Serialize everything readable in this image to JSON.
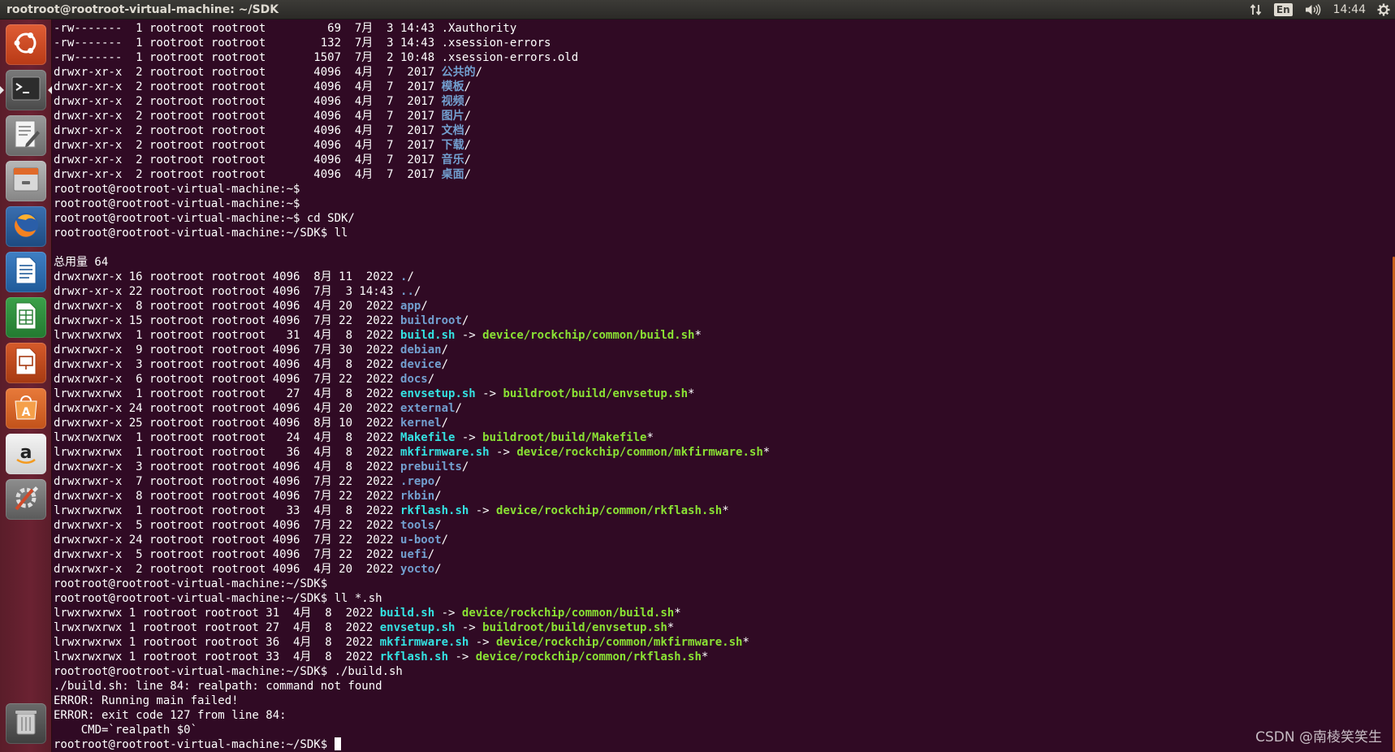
{
  "window": {
    "title": "rootroot@rootroot-virtual-machine: ~/SDK"
  },
  "panel": {
    "keyboard_layout": "En",
    "time": "14:44",
    "icons": [
      "network-arrows-icon",
      "keyboard-layout-indicator",
      "volume-icon",
      "gear-icon"
    ]
  },
  "launcher": {
    "items": [
      {
        "name": "dash-home",
        "icon": "ubuntu-logo-icon"
      },
      {
        "name": "terminal",
        "icon": "terminal-icon",
        "active": true
      },
      {
        "name": "text-editor",
        "icon": "text-editor-icon"
      },
      {
        "name": "files",
        "icon": "file-cabinet-icon"
      },
      {
        "name": "firefox",
        "icon": "firefox-icon"
      },
      {
        "name": "libreoffice-writer",
        "icon": "writer-document-icon"
      },
      {
        "name": "libreoffice-calc",
        "icon": "calc-spreadsheet-icon"
      },
      {
        "name": "libreoffice-impress",
        "icon": "impress-presentation-icon"
      },
      {
        "name": "software-center",
        "icon": "shopping-bag-icon"
      },
      {
        "name": "amazon",
        "icon": "amazon-icon"
      },
      {
        "name": "system-settings",
        "icon": "settings-tools-icon"
      },
      {
        "name": "trash",
        "icon": "trash-icon"
      }
    ],
    "colors": {
      "background": "#6b2232",
      "terminal_bg": "#300a24"
    }
  },
  "terminal": {
    "lines": [
      [
        {
          "t": "-rw-------  1 rootroot rootroot         69  7月  3 14:43 .Xauthority"
        }
      ],
      [
        {
          "t": "-rw-------  1 rootroot rootroot        132  7月  3 14:43 .xsession-errors"
        }
      ],
      [
        {
          "t": "-rw-------  1 rootroot rootroot       1507  7月  2 10:48 .xsession-errors.old"
        }
      ],
      [
        {
          "t": "drwxr-xr-x  2 rootroot rootroot       4096  4月  7  2017 "
        },
        {
          "t": "公共的",
          "c": "dir"
        },
        {
          "t": "/"
        }
      ],
      [
        {
          "t": "drwxr-xr-x  2 rootroot rootroot       4096  4月  7  2017 "
        },
        {
          "t": "模板",
          "c": "dir"
        },
        {
          "t": "/"
        }
      ],
      [
        {
          "t": "drwxr-xr-x  2 rootroot rootroot       4096  4月  7  2017 "
        },
        {
          "t": "视频",
          "c": "dir"
        },
        {
          "t": "/"
        }
      ],
      [
        {
          "t": "drwxr-xr-x  2 rootroot rootroot       4096  4月  7  2017 "
        },
        {
          "t": "图片",
          "c": "dir"
        },
        {
          "t": "/"
        }
      ],
      [
        {
          "t": "drwxr-xr-x  2 rootroot rootroot       4096  4月  7  2017 "
        },
        {
          "t": "文档",
          "c": "dir"
        },
        {
          "t": "/"
        }
      ],
      [
        {
          "t": "drwxr-xr-x  2 rootroot rootroot       4096  4月  7  2017 "
        },
        {
          "t": "下载",
          "c": "dir"
        },
        {
          "t": "/"
        }
      ],
      [
        {
          "t": "drwxr-xr-x  2 rootroot rootroot       4096  4月  7  2017 "
        },
        {
          "t": "音乐",
          "c": "dir"
        },
        {
          "t": "/"
        }
      ],
      [
        {
          "t": "drwxr-xr-x  2 rootroot rootroot       4096  4月  7  2017 "
        },
        {
          "t": "桌面",
          "c": "dir"
        },
        {
          "t": "/"
        }
      ],
      [
        {
          "t": "rootroot@rootroot-virtual-machine:~$"
        }
      ],
      [
        {
          "t": "rootroot@rootroot-virtual-machine:~$"
        }
      ],
      [
        {
          "t": "rootroot@rootroot-virtual-machine:~$ cd SDK/"
        }
      ],
      [
        {
          "t": "rootroot@rootroot-virtual-machine:~/SDK$ ll"
        }
      ],
      [
        {
          "t": ""
        }
      ],
      [
        {
          "t": "总用量 64"
        }
      ],
      [
        {
          "t": "drwxrwxr-x 16 rootroot rootroot 4096  8月 11  2022 "
        },
        {
          "t": ".",
          "c": "dir"
        },
        {
          "t": "/"
        }
      ],
      [
        {
          "t": "drwxr-xr-x 22 rootroot rootroot 4096  7月  3 14:43 "
        },
        {
          "t": "..",
          "c": "dir"
        },
        {
          "t": "/"
        }
      ],
      [
        {
          "t": "drwxrwxr-x  8 rootroot rootroot 4096  4月 20  2022 "
        },
        {
          "t": "app",
          "c": "dir"
        },
        {
          "t": "/"
        }
      ],
      [
        {
          "t": "drwxrwxr-x 15 rootroot rootroot 4096  7月 22  2022 "
        },
        {
          "t": "buildroot",
          "c": "dir"
        },
        {
          "t": "/"
        }
      ],
      [
        {
          "t": "lrwxrwxrwx  1 rootroot rootroot   31  4月  8  2022 "
        },
        {
          "t": "build.sh",
          "c": "link"
        },
        {
          "t": " -> "
        },
        {
          "t": "device/rockchip/common/build.sh",
          "c": "exe"
        },
        {
          "t": "*"
        }
      ],
      [
        {
          "t": "drwxrwxr-x  9 rootroot rootroot 4096  7月 30  2022 "
        },
        {
          "t": "debian",
          "c": "dir"
        },
        {
          "t": "/"
        }
      ],
      [
        {
          "t": "drwxrwxr-x  3 rootroot rootroot 4096  4月  8  2022 "
        },
        {
          "t": "device",
          "c": "dir"
        },
        {
          "t": "/"
        }
      ],
      [
        {
          "t": "drwxrwxr-x  6 rootroot rootroot 4096  7月 22  2022 "
        },
        {
          "t": "docs",
          "c": "dir"
        },
        {
          "t": "/"
        }
      ],
      [
        {
          "t": "lrwxrwxrwx  1 rootroot rootroot   27  4月  8  2022 "
        },
        {
          "t": "envsetup.sh",
          "c": "link"
        },
        {
          "t": " -> "
        },
        {
          "t": "buildroot/build/envsetup.sh",
          "c": "exe"
        },
        {
          "t": "*"
        }
      ],
      [
        {
          "t": "drwxrwxr-x 24 rootroot rootroot 4096  4月 20  2022 "
        },
        {
          "t": "external",
          "c": "dir"
        },
        {
          "t": "/"
        }
      ],
      [
        {
          "t": "drwxrwxr-x 25 rootroot rootroot 4096  8月 10  2022 "
        },
        {
          "t": "kernel",
          "c": "dir"
        },
        {
          "t": "/"
        }
      ],
      [
        {
          "t": "lrwxrwxrwx  1 rootroot rootroot   24  4月  8  2022 "
        },
        {
          "t": "Makefile",
          "c": "link"
        },
        {
          "t": " -> "
        },
        {
          "t": "buildroot/build/Makefile",
          "c": "exe"
        },
        {
          "t": "*"
        }
      ],
      [
        {
          "t": "lrwxrwxrwx  1 rootroot rootroot   36  4月  8  2022 "
        },
        {
          "t": "mkfirmware.sh",
          "c": "link"
        },
        {
          "t": " -> "
        },
        {
          "t": "device/rockchip/common/mkfirmware.sh",
          "c": "exe"
        },
        {
          "t": "*"
        }
      ],
      [
        {
          "t": "drwxrwxr-x  3 rootroot rootroot 4096  4月  8  2022 "
        },
        {
          "t": "prebuilts",
          "c": "dir"
        },
        {
          "t": "/"
        }
      ],
      [
        {
          "t": "drwxrwxr-x  7 rootroot rootroot 4096  7月 22  2022 "
        },
        {
          "t": ".repo",
          "c": "dir"
        },
        {
          "t": "/"
        }
      ],
      [
        {
          "t": "drwxrwxr-x  8 rootroot rootroot 4096  7月 22  2022 "
        },
        {
          "t": "rkbin",
          "c": "dir"
        },
        {
          "t": "/"
        }
      ],
      [
        {
          "t": "lrwxrwxrwx  1 rootroot rootroot   33  4月  8  2022 "
        },
        {
          "t": "rkflash.sh",
          "c": "link"
        },
        {
          "t": " -> "
        },
        {
          "t": "device/rockchip/common/rkflash.sh",
          "c": "exe"
        },
        {
          "t": "*"
        }
      ],
      [
        {
          "t": "drwxrwxr-x  5 rootroot rootroot 4096  7月 22  2022 "
        },
        {
          "t": "tools",
          "c": "dir"
        },
        {
          "t": "/"
        }
      ],
      [
        {
          "t": "drwxrwxr-x 24 rootroot rootroot 4096  7月 22  2022 "
        },
        {
          "t": "u-boot",
          "c": "dir"
        },
        {
          "t": "/"
        }
      ],
      [
        {
          "t": "drwxrwxr-x  5 rootroot rootroot 4096  7月 22  2022 "
        },
        {
          "t": "uefi",
          "c": "dir"
        },
        {
          "t": "/"
        }
      ],
      [
        {
          "t": "drwxrwxr-x  2 rootroot rootroot 4096  4月 20  2022 "
        },
        {
          "t": "yocto",
          "c": "dir"
        },
        {
          "t": "/"
        }
      ],
      [
        {
          "t": "rootroot@rootroot-virtual-machine:~/SDK$"
        }
      ],
      [
        {
          "t": "rootroot@rootroot-virtual-machine:~/SDK$ ll *.sh"
        }
      ],
      [
        {
          "t": "lrwxrwxrwx 1 rootroot rootroot 31  4月  8  2022 "
        },
        {
          "t": "build.sh",
          "c": "link"
        },
        {
          "t": " -> "
        },
        {
          "t": "device/rockchip/common/build.sh",
          "c": "exe"
        },
        {
          "t": "*"
        }
      ],
      [
        {
          "t": "lrwxrwxrwx 1 rootroot rootroot 27  4月  8  2022 "
        },
        {
          "t": "envsetup.sh",
          "c": "link"
        },
        {
          "t": " -> "
        },
        {
          "t": "buildroot/build/envsetup.sh",
          "c": "exe"
        },
        {
          "t": "*"
        }
      ],
      [
        {
          "t": "lrwxrwxrwx 1 rootroot rootroot 36  4月  8  2022 "
        },
        {
          "t": "mkfirmware.sh",
          "c": "link"
        },
        {
          "t": " -> "
        },
        {
          "t": "device/rockchip/common/mkfirmware.sh",
          "c": "exe"
        },
        {
          "t": "*"
        }
      ],
      [
        {
          "t": "lrwxrwxrwx 1 rootroot rootroot 33  4月  8  2022 "
        },
        {
          "t": "rkflash.sh",
          "c": "link"
        },
        {
          "t": " -> "
        },
        {
          "t": "device/rockchip/common/rkflash.sh",
          "c": "exe"
        },
        {
          "t": "*"
        }
      ],
      [
        {
          "t": "rootroot@rootroot-virtual-machine:~/SDK$ ./build.sh"
        }
      ],
      [
        {
          "t": "./build.sh: line 84: realpath: command not found"
        }
      ],
      [
        {
          "t": "ERROR: Running main failed!"
        }
      ],
      [
        {
          "t": "ERROR: exit code 127 from line 84:"
        }
      ],
      [
        {
          "t": "    CMD=`realpath $0`"
        }
      ],
      [
        {
          "t": "rootroot@rootroot-virtual-machine:~/SDK$ "
        },
        {
          "t": "",
          "c": "cursor"
        }
      ]
    ],
    "colors": {
      "directory": "#729fcf",
      "symlink": "#34e2e2",
      "executable": "#8ae234",
      "text": "#ffffff"
    }
  },
  "watermark": "CSDN @南棱笑笑生"
}
